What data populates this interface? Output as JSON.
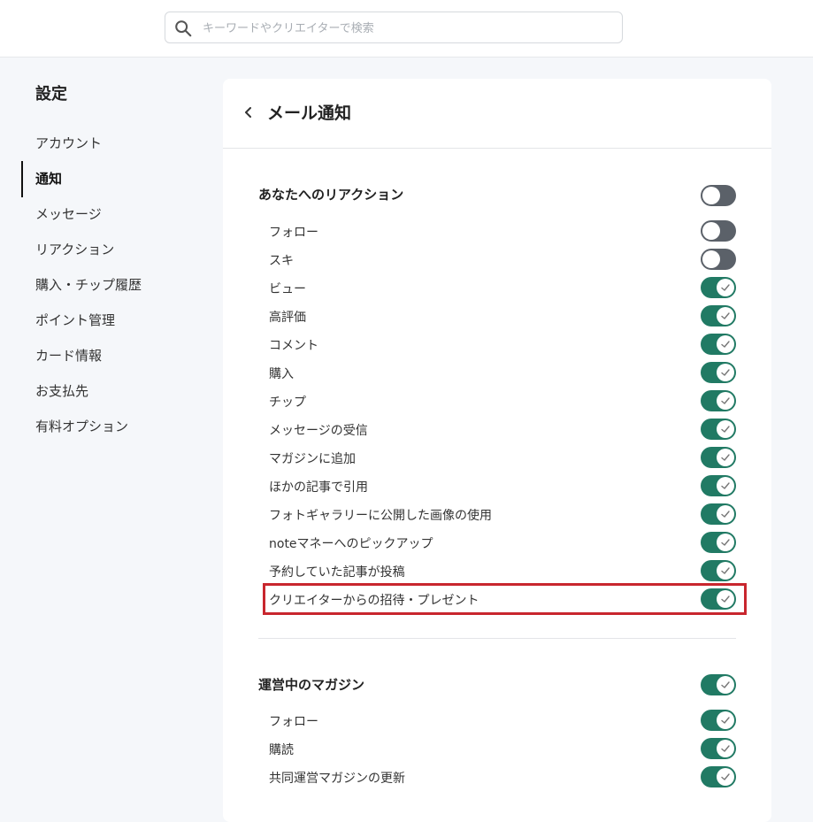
{
  "search": {
    "placeholder": "キーワードやクリエイターで検索"
  },
  "sidebar": {
    "title": "設定",
    "items": [
      {
        "label": "アカウント",
        "active": false
      },
      {
        "label": "通知",
        "active": true
      },
      {
        "label": "メッセージ",
        "active": false
      },
      {
        "label": "リアクション",
        "active": false
      },
      {
        "label": "購入・チップ履歴",
        "active": false
      },
      {
        "label": "ポイント管理",
        "active": false
      },
      {
        "label": "カード情報",
        "active": false
      },
      {
        "label": "お支払先",
        "active": false
      },
      {
        "label": "有料オプション",
        "active": false
      }
    ]
  },
  "panel": {
    "title": "メール通知",
    "sections": [
      {
        "label": "あなたへのリアクション",
        "enabled": false,
        "rows": [
          {
            "label": "フォロー",
            "enabled": false
          },
          {
            "label": "スキ",
            "enabled": false
          },
          {
            "label": "ビュー",
            "enabled": true
          },
          {
            "label": "高評価",
            "enabled": true
          },
          {
            "label": "コメント",
            "enabled": true
          },
          {
            "label": "購入",
            "enabled": true
          },
          {
            "label": "チップ",
            "enabled": true
          },
          {
            "label": "メッセージの受信",
            "enabled": true
          },
          {
            "label": "マガジンに追加",
            "enabled": true
          },
          {
            "label": "ほかの記事で引用",
            "enabled": true
          },
          {
            "label": "フォトギャラリーに公開した画像の使用",
            "enabled": true
          },
          {
            "label": "noteマネーへのピックアップ",
            "enabled": true
          },
          {
            "label": "予約していた記事が投稿",
            "enabled": true
          },
          {
            "label": "クリエイターからの招待・プレゼント",
            "enabled": true
          }
        ]
      },
      {
        "label": "運営中のマガジン",
        "enabled": true,
        "rows": [
          {
            "label": "フォロー",
            "enabled": true
          },
          {
            "label": "購読",
            "enabled": true
          },
          {
            "label": "共同運営マガジンの更新",
            "enabled": true
          }
        ]
      }
    ]
  },
  "colors": {
    "toggle_on": "#217a64",
    "toggle_off": "#5b6169",
    "highlight": "#c8262e"
  }
}
